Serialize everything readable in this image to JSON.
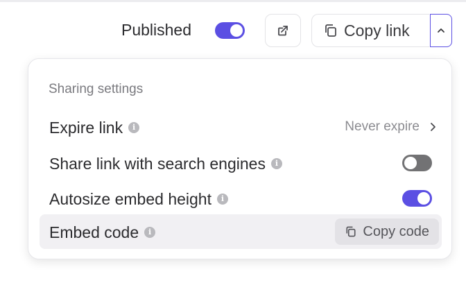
{
  "toolbar": {
    "published_label": "Published",
    "published_on": true,
    "copy_link_label": "Copy link"
  },
  "panel": {
    "title": "Sharing settings",
    "rows": [
      {
        "label": "Expire link",
        "value": "Never expire"
      },
      {
        "label": "Share link with search engines",
        "toggle_on": false
      },
      {
        "label": "Autosize embed height",
        "toggle_on": true
      },
      {
        "label": "Embed code",
        "button_label": "Copy code"
      }
    ]
  },
  "icons": {
    "info": "i",
    "open": "external-link-icon",
    "copy": "copy-icon",
    "caret": "chevron-up-icon",
    "chevron": "chevron-right-icon"
  },
  "colors": {
    "accent": "#5b4fe3",
    "toggle_off": "#727274"
  }
}
